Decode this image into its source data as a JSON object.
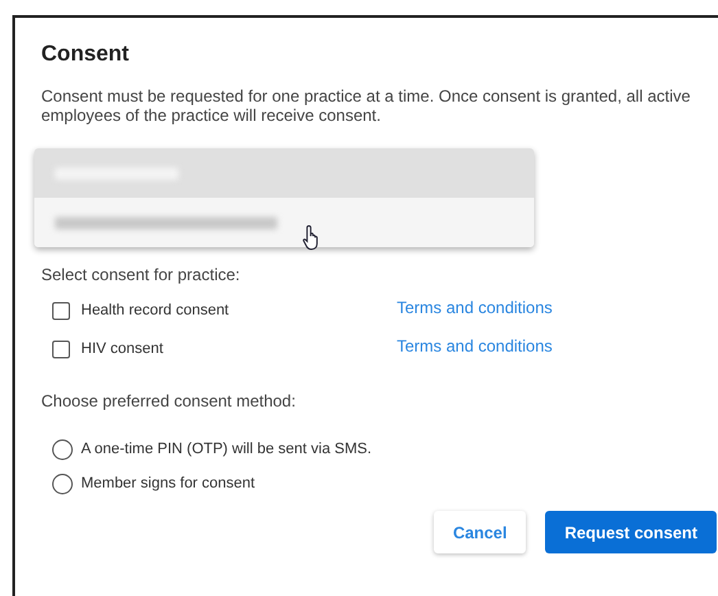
{
  "dialog": {
    "title": "Consent",
    "description": "Consent must be requested for one practice at a time. Once consent is granted, all active employees of the practice will receive consent."
  },
  "practice_menu": {
    "options": [
      {
        "selected": true
      },
      {
        "selected": false
      }
    ]
  },
  "consent_section": {
    "label": "Select consent for practice:",
    "items": [
      {
        "label": "Health record consent",
        "checked": false,
        "link": "Terms and conditions"
      },
      {
        "label": "HIV consent",
        "checked": false,
        "link": "Terms and conditions"
      }
    ]
  },
  "method_section": {
    "label": "Choose preferred consent method:",
    "options": [
      {
        "label": "A one-time PIN (OTP) will be sent via SMS.",
        "selected": false
      },
      {
        "label": "Member signs for consent",
        "selected": false
      }
    ]
  },
  "buttons": [
    {
      "label": "Cancel",
      "kind": "secondary"
    },
    {
      "label": "Request consent",
      "kind": "primary"
    }
  ]
}
